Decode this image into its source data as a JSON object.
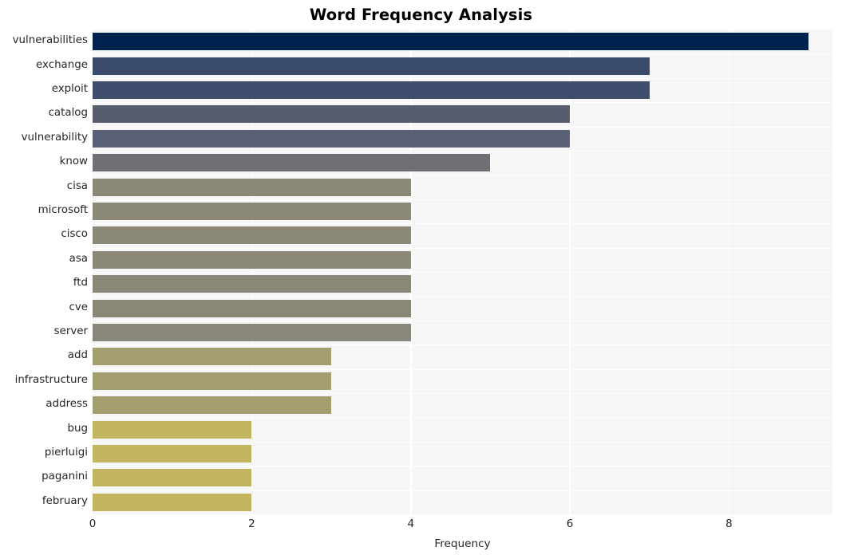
{
  "chart_data": {
    "type": "bar",
    "orientation": "horizontal",
    "title": "Word Frequency Analysis",
    "xlabel": "Frequency",
    "ylabel": "",
    "categories": [
      "vulnerabilities",
      "exchange",
      "exploit",
      "catalog",
      "vulnerability",
      "know",
      "cisa",
      "microsoft",
      "cisco",
      "asa",
      "ftd",
      "cve",
      "server",
      "add",
      "infrastructure",
      "address",
      "bug",
      "pierluigi",
      "paganini",
      "february"
    ],
    "values": [
      9,
      7,
      7,
      6,
      6,
      5,
      4,
      4,
      4,
      4,
      4,
      4,
      4,
      3,
      3,
      3,
      2,
      2,
      2,
      2
    ],
    "bar_colors": [
      "#00224e",
      "#3b4b6b",
      "#3f4d6d",
      "#575d6d",
      "#5a6075",
      "#6e7076",
      "#8b8878",
      "#8b8878",
      "#8b8878",
      "#8b8878",
      "#8a8777",
      "#8a8777",
      "#89867a",
      "#a49d6f",
      "#a49d6f",
      "#a49d6f",
      "#c3b55f",
      "#c3b55f",
      "#c3b55f",
      "#c3b55f"
    ],
    "xlim": [
      0,
      9.3
    ],
    "xticks": [
      0,
      2,
      4,
      6,
      8
    ],
    "xtick_labels": [
      "0",
      "2",
      "4",
      "6",
      "8"
    ],
    "grid": true,
    "grid_color": "#ffffff",
    "plot_background": "#f6f6f6",
    "figure_background": "#ffffff",
    "legend": null
  }
}
